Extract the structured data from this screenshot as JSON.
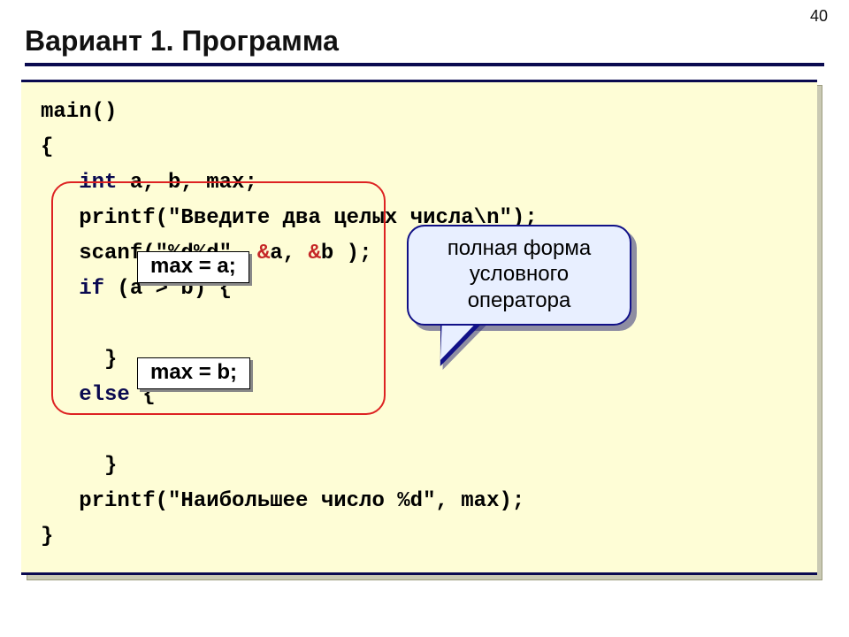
{
  "page_number": "40",
  "title": "Вариант 1. Программа",
  "code": {
    "l1": "main()",
    "l2": "{",
    "l3a": "   int",
    "l3b": " a, b, max;",
    "l4a": "   printf(\"Введите два целых числа\\n\");",
    "l5a": "   scanf(\"%d%d\", ",
    "l5amp1": "&",
    "l5b": "a, ",
    "l5amp2": "&",
    "l5c": "b );",
    "l6a": "   if",
    "l6b": " (a > b) {",
    "l7": "",
    "l8": "     }",
    "l9a": "   else",
    "l9b": " {",
    "l10": "",
    "l11": "     }",
    "l12": "   printf(\"Наибольшее число %d\", max);",
    "l13": "}"
  },
  "assign_a": "max = a;",
  "assign_b": "max = b;",
  "callout": "полная форма\nусловного\nоператора"
}
